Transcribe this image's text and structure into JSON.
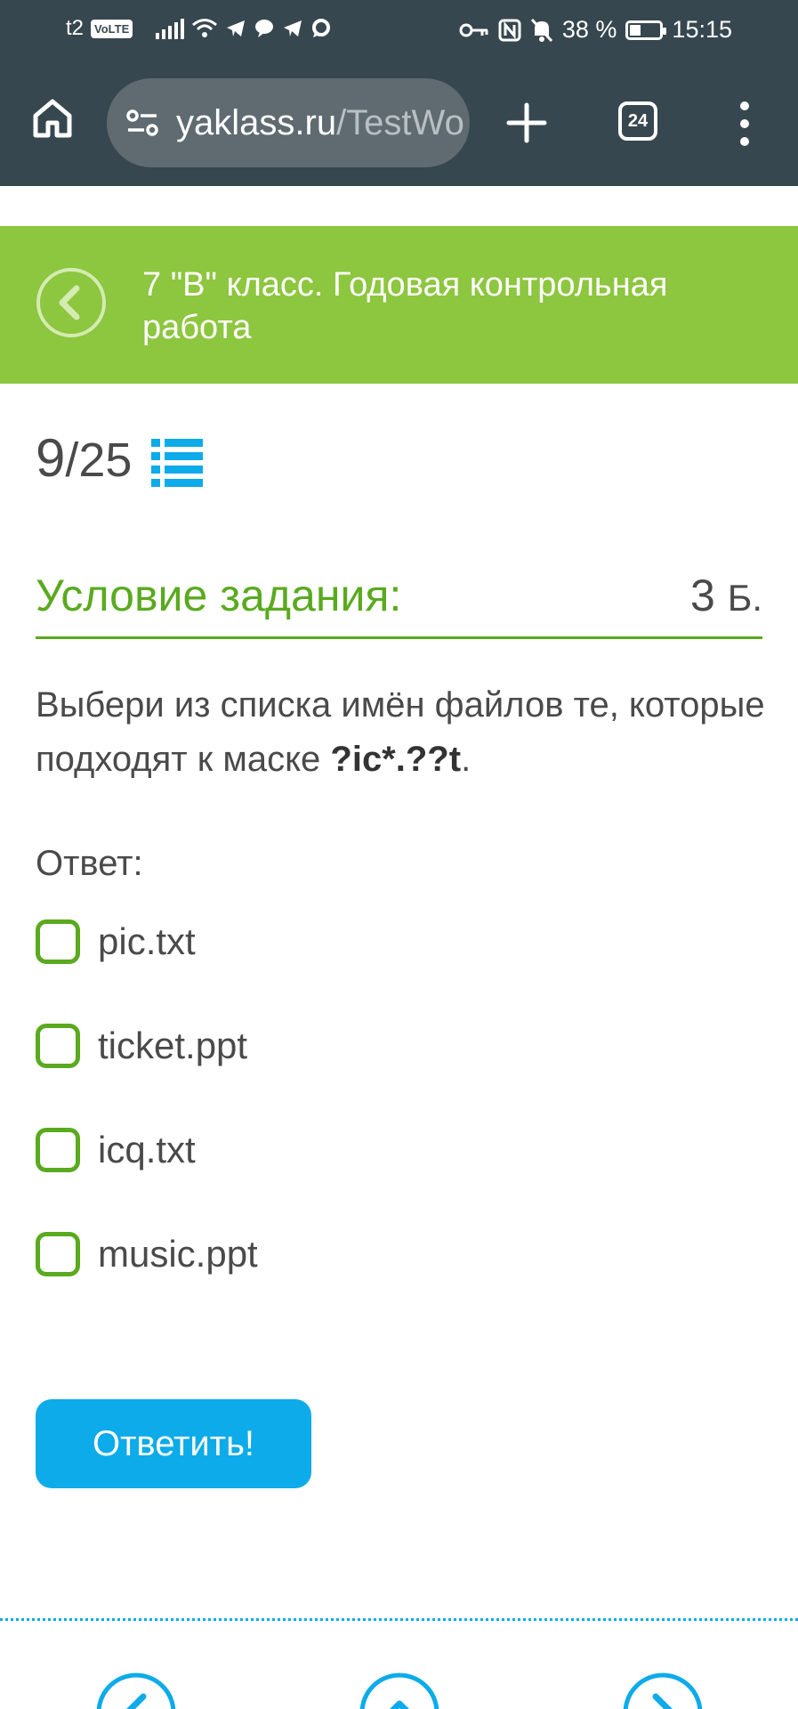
{
  "status_bar": {
    "carrier": "t2",
    "volte": "VoLTE",
    "battery_text": "38 %",
    "battery_level": 0.38,
    "time": "15:15"
  },
  "browser": {
    "url_host": "yaklass.ru",
    "url_path": "/TestWo",
    "tab_count": "24"
  },
  "header": {
    "title": "7 \"В\" класс. Годовая контрольная работа"
  },
  "progress": {
    "current": "9",
    "total": "/25"
  },
  "condition": {
    "label": "Условие задания:",
    "points": "3",
    "points_unit": "Б."
  },
  "task": {
    "text_before": "Выбери из списка имён файлов те, которые подходят к маске ",
    "mask": "?ic*.??t",
    "text_after": "."
  },
  "answer": {
    "label": "Ответ:",
    "options": [
      {
        "label": "pic.txt",
        "checked": false
      },
      {
        "label": "ticket.ppt",
        "checked": false
      },
      {
        "label": "icq.txt",
        "checked": false
      },
      {
        "label": "music.ppt",
        "checked": false
      }
    ]
  },
  "submit_label": "Ответить!",
  "colors": {
    "browser_bar": "#37474f",
    "header_green": "#8dc63f",
    "accent_green": "#5aaa1f",
    "button_blue": "#0dabe9"
  },
  "icons": {
    "home": "home-icon",
    "site_settings": "tune-icon",
    "new_tab": "plus-icon",
    "tabs": "tabs-count-icon",
    "menu": "more-vert-icon",
    "back": "chevron-left-circle-icon",
    "task_list": "list-icon",
    "prev": "chevron-left-circle-icon",
    "up": "chevron-up-circle-icon",
    "next": "chevron-right-circle-icon"
  }
}
